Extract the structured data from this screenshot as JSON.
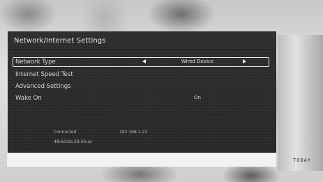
{
  "panel": {
    "title": "Network/Internet Settings"
  },
  "menu": {
    "items": [
      {
        "label": "Network Type",
        "value": "Wired Device",
        "selected": true
      },
      {
        "label": "Internet Speed Test"
      },
      {
        "label": "Advanced Settings"
      },
      {
        "label": "Wake On",
        "value": "On"
      }
    ]
  },
  "status": {
    "connection": "Connected",
    "ip_address": "192.168.1.23",
    "mac_address": "48:6d:bb:29:59:ac"
  },
  "background": {
    "sign_text": "TODAY"
  },
  "colors": {
    "panel_bg": "#2b2b2b",
    "text": "#d6d6d6",
    "highlight_border": "#e8e8e8"
  }
}
